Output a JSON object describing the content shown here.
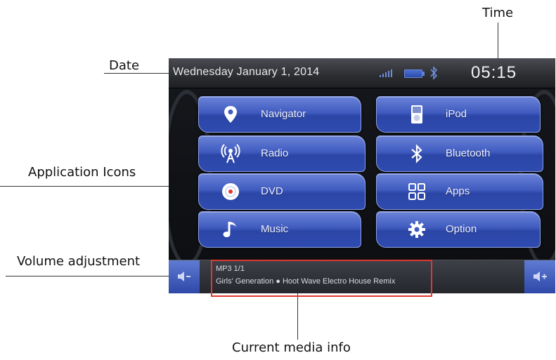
{
  "callouts": {
    "time": "Time",
    "date": "Date",
    "app_icons": "Application Icons",
    "volume": "Volume adjustment",
    "media": "Current media info"
  },
  "status": {
    "date": "Wednesday  January 1, 2014",
    "time": "05:15"
  },
  "apps": {
    "left": [
      {
        "label": "Navigator",
        "icon": "location-pin-icon"
      },
      {
        "label": "Radio",
        "icon": "radio-antenna-icon"
      },
      {
        "label": "DVD",
        "icon": "disc-icon"
      },
      {
        "label": "Music",
        "icon": "music-note-icon"
      }
    ],
    "right": [
      {
        "label": "iPod",
        "icon": "ipod-icon"
      },
      {
        "label": "Bluetooth",
        "icon": "bluetooth-icon"
      },
      {
        "label": "Apps",
        "icon": "apps-grid-icon"
      },
      {
        "label": "Option",
        "icon": "gear-icon"
      }
    ]
  },
  "media": {
    "line1": "MP3 1/1",
    "line2": "Girls' Generation  ●  Hoot Wave Electro House Remix"
  },
  "colors": {
    "tile": "#3f5bbf",
    "highlight_box": "#e0382f"
  }
}
